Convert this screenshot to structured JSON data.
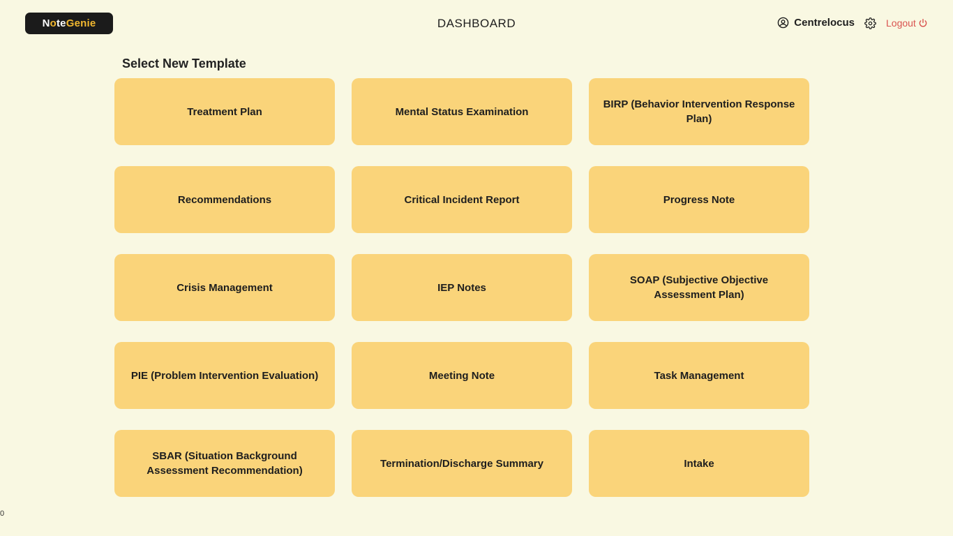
{
  "header": {
    "logo": {
      "part1": "N",
      "dot": "o",
      "part2": "te",
      "part3": "Gen",
      "part4": "ie"
    },
    "title": "DASHBOARD",
    "username": "Centrelocus",
    "logout_label": "Logout"
  },
  "main": {
    "section_title": "Select New Template",
    "templates": [
      "Treatment Plan",
      "Mental Status Examination",
      "BIRP (Behavior Intervention Response Plan)",
      "Recommendations",
      "Critical Incident Report",
      "Progress Note",
      "Crisis Management",
      "IEP Notes",
      "SOAP (Subjective Objective Assessment Plan)",
      "PIE (Problem Intervention Evaluation)",
      "Meeting Note",
      "Task Management",
      "SBAR (Situation Background Assessment Recommendation)",
      "Termination/Discharge Summary",
      "Intake"
    ]
  },
  "footer": {
    "counter": "0"
  },
  "colors": {
    "background": "#f9f8e2",
    "card": "#fad47a",
    "logo_bg": "#1b1b1b",
    "logo_accent": "#f2b830",
    "logout": "#d9534f"
  },
  "icons": {
    "user": "user-circle-icon",
    "settings": "gear-icon",
    "logout": "power-icon"
  }
}
